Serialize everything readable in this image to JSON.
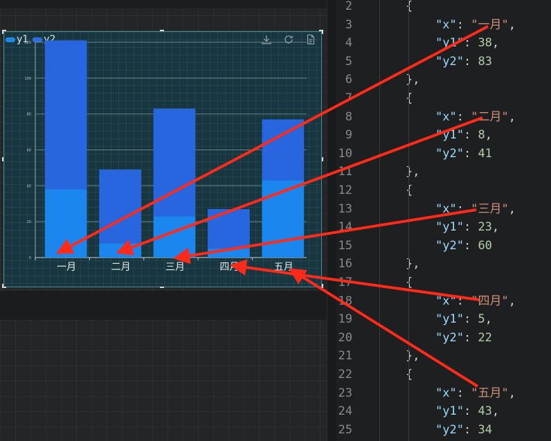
{
  "chart": {
    "legend": [
      {
        "name": "y1",
        "color": "#1e88e5"
      },
      {
        "name": "y2",
        "color": "#2a6de0"
      }
    ],
    "toolbox_icons": [
      "download-icon",
      "refresh-icon",
      "data-view-icon"
    ],
    "colors": {
      "y1": "#1a86ee",
      "y2": "#2866e0"
    }
  },
  "chart_data": {
    "type": "bar",
    "stacked": true,
    "categories": [
      "一月",
      "二月",
      "三月",
      "四月",
      "五月"
    ],
    "series": [
      {
        "name": "y1",
        "values": [
          38,
          8,
          23,
          5,
          43
        ]
      },
      {
        "name": "y2",
        "values": [
          83,
          41,
          60,
          22,
          34
        ]
      }
    ],
    "ylim": [
      0,
      120
    ],
    "yticks": [
      0,
      20,
      40,
      60,
      80,
      100,
      120
    ],
    "grid": true,
    "legend_position": "top-left"
  },
  "editor": {
    "lines": [
      {
        "n": "2",
        "indent": 1,
        "tokens": [
          {
            "t": "{",
            "c": "p"
          }
        ]
      },
      {
        "n": "3",
        "indent": 2,
        "tokens": [
          {
            "t": "\"x\"",
            "c": "k"
          },
          {
            "t": ": ",
            "c": "p"
          },
          {
            "t": "\"一月\"",
            "c": "s"
          },
          {
            "t": ",",
            "c": "p"
          }
        ]
      },
      {
        "n": "4",
        "indent": 2,
        "tokens": [
          {
            "t": "\"y1\"",
            "c": "k"
          },
          {
            "t": ": ",
            "c": "p"
          },
          {
            "t": "38",
            "c": "n"
          },
          {
            "t": ",",
            "c": "p"
          }
        ]
      },
      {
        "n": "5",
        "indent": 2,
        "tokens": [
          {
            "t": "\"y2\"",
            "c": "k"
          },
          {
            "t": ": ",
            "c": "p"
          },
          {
            "t": "83",
            "c": "n"
          }
        ]
      },
      {
        "n": "6",
        "indent": 1,
        "tokens": [
          {
            "t": "},",
            "c": "p"
          }
        ]
      },
      {
        "n": "7",
        "indent": 1,
        "tokens": [
          {
            "t": "{",
            "c": "p"
          }
        ]
      },
      {
        "n": "8",
        "indent": 2,
        "tokens": [
          {
            "t": "\"x\"",
            "c": "k"
          },
          {
            "t": ": ",
            "c": "p"
          },
          {
            "t": "\"二月\"",
            "c": "s"
          },
          {
            "t": ",",
            "c": "p"
          }
        ]
      },
      {
        "n": "9",
        "indent": 2,
        "tokens": [
          {
            "t": "\"y1\"",
            "c": "k"
          },
          {
            "t": ": ",
            "c": "p"
          },
          {
            "t": "8",
            "c": "n"
          },
          {
            "t": ",",
            "c": "p"
          }
        ]
      },
      {
        "n": "10",
        "indent": 2,
        "tokens": [
          {
            "t": "\"y2\"",
            "c": "k"
          },
          {
            "t": ": ",
            "c": "p"
          },
          {
            "t": "41",
            "c": "n"
          }
        ]
      },
      {
        "n": "11",
        "indent": 1,
        "tokens": [
          {
            "t": "},",
            "c": "p"
          }
        ]
      },
      {
        "n": "12",
        "indent": 1,
        "tokens": [
          {
            "t": "{",
            "c": "p"
          }
        ]
      },
      {
        "n": "13",
        "indent": 2,
        "tokens": [
          {
            "t": "\"x\"",
            "c": "k"
          },
          {
            "t": ": ",
            "c": "p"
          },
          {
            "t": "\"三月\"",
            "c": "s"
          },
          {
            "t": ",",
            "c": "p"
          }
        ]
      },
      {
        "n": "14",
        "indent": 2,
        "tokens": [
          {
            "t": "\"y1\"",
            "c": "k"
          },
          {
            "t": ": ",
            "c": "p"
          },
          {
            "t": "23",
            "c": "n"
          },
          {
            "t": ",",
            "c": "p"
          }
        ]
      },
      {
        "n": "15",
        "indent": 2,
        "tokens": [
          {
            "t": "\"y2\"",
            "c": "k"
          },
          {
            "t": ": ",
            "c": "p"
          },
          {
            "t": "60",
            "c": "n"
          }
        ]
      },
      {
        "n": "16",
        "indent": 1,
        "tokens": [
          {
            "t": "},",
            "c": "p"
          }
        ]
      },
      {
        "n": "17",
        "indent": 1,
        "tokens": [
          {
            "t": "{",
            "c": "p"
          }
        ]
      },
      {
        "n": "18",
        "indent": 2,
        "tokens": [
          {
            "t": "\"x\"",
            "c": "k"
          },
          {
            "t": ": ",
            "c": "p"
          },
          {
            "t": "\"四月\"",
            "c": "s"
          },
          {
            "t": ",",
            "c": "p"
          }
        ]
      },
      {
        "n": "19",
        "indent": 2,
        "tokens": [
          {
            "t": "\"y1\"",
            "c": "k"
          },
          {
            "t": ": ",
            "c": "p"
          },
          {
            "t": "5",
            "c": "n"
          },
          {
            "t": ",",
            "c": "p"
          }
        ]
      },
      {
        "n": "20",
        "indent": 2,
        "tokens": [
          {
            "t": "\"y2\"",
            "c": "k"
          },
          {
            "t": ": ",
            "c": "p"
          },
          {
            "t": "22",
            "c": "n"
          }
        ]
      },
      {
        "n": "21",
        "indent": 1,
        "tokens": [
          {
            "t": "},",
            "c": "p"
          }
        ]
      },
      {
        "n": "22",
        "indent": 1,
        "tokens": [
          {
            "t": "{",
            "c": "p"
          }
        ]
      },
      {
        "n": "23",
        "indent": 2,
        "tokens": [
          {
            "t": "\"x\"",
            "c": "k"
          },
          {
            "t": ": ",
            "c": "p"
          },
          {
            "t": "\"五月\"",
            "c": "s"
          },
          {
            "t": ",",
            "c": "p"
          }
        ]
      },
      {
        "n": "24",
        "indent": 2,
        "tokens": [
          {
            "t": "\"y1\"",
            "c": "k"
          },
          {
            "t": ": ",
            "c": "p"
          },
          {
            "t": "43",
            "c": "n"
          },
          {
            "t": ",",
            "c": "p"
          }
        ]
      },
      {
        "n": "25",
        "indent": 2,
        "tokens": [
          {
            "t": "\"y2\"",
            "c": "k"
          },
          {
            "t": ": ",
            "c": "p"
          },
          {
            "t": "34",
            "c": "n"
          }
        ]
      }
    ]
  },
  "annotation": {
    "arrow_color": "#ff2a1a"
  }
}
